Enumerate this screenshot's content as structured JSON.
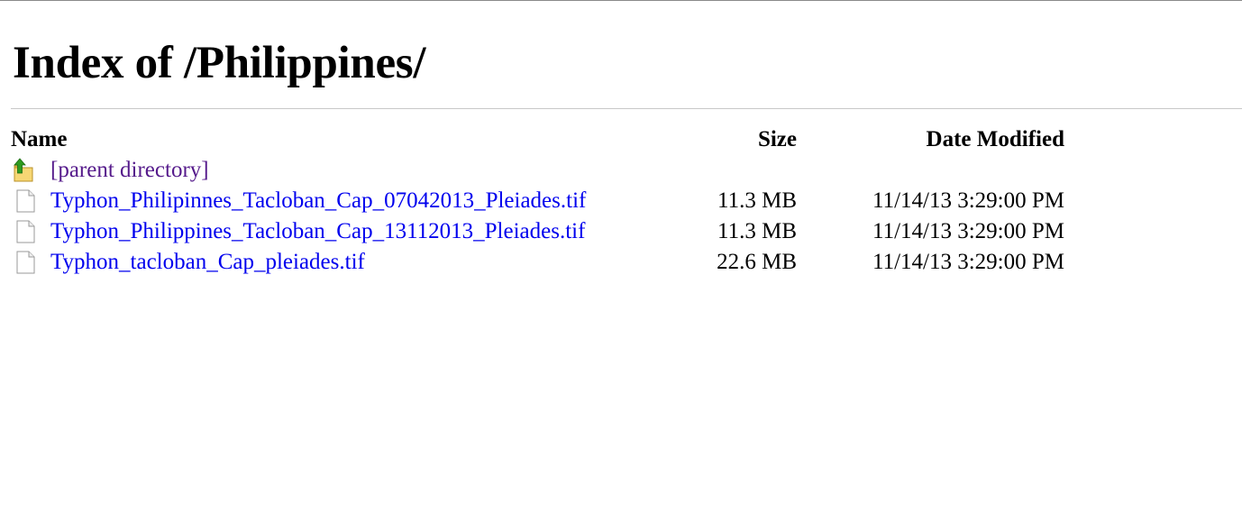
{
  "page": {
    "title": "Index of /Philippines/"
  },
  "table": {
    "headers": {
      "name": "Name",
      "size": "Size",
      "date": "Date Modified"
    },
    "parent": {
      "label": "[parent directory]",
      "icon": "folder-up-icon"
    },
    "rows": [
      {
        "name": "Typhon_Philipinnes_Tacloban_Cap_07042013_Pleiades.tif",
        "size": "11.3 MB",
        "date": "11/14/13 3:29:00 PM",
        "icon": "file-icon"
      },
      {
        "name": "Typhon_Philippines_Tacloban_Cap_13112013_Pleiades.tif",
        "size": "11.3 MB",
        "date": "11/14/13 3:29:00 PM",
        "icon": "file-icon"
      },
      {
        "name": "Typhon_tacloban_Cap_pleiades.tif",
        "size": "22.6 MB",
        "date": "11/14/13 3:29:00 PM",
        "icon": "file-icon"
      }
    ]
  },
  "colors": {
    "link": "#0000ee",
    "visited_link": "#551a8b",
    "rule": "#c8c8c8"
  }
}
